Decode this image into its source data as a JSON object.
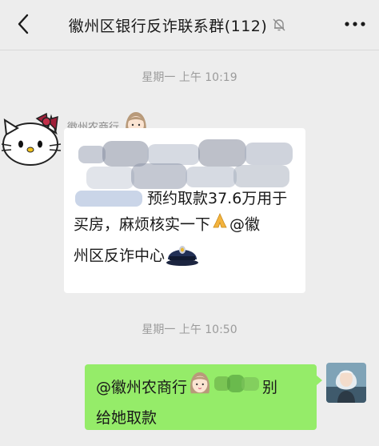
{
  "header": {
    "title": "徽州区银行反诈联系群(112)",
    "back_icon": "chevron-left-icon",
    "mute_icon": "bell-off-icon",
    "more_icon": "more-dots-icon"
  },
  "messages": [
    {
      "timestamp": "星期一 上午 10:19",
      "sender": "徽州农商行",
      "text_visible": "预约取款37.6万用于买房，麻烦核实一下",
      "line1": "预约取款37.6万用于",
      "line2": "买房，麻烦核实一下",
      "mention": "@徽",
      "line3": "州区反诈中心",
      "emoji": [
        "pray-hands",
        "police-officer"
      ]
    },
    {
      "timestamp": "星期一 上午 10:50",
      "line1_prefix": "@徽州农商行",
      "line1_suffix": "别",
      "line2": "给她取款"
    }
  ],
  "colors": {
    "background": "#ededed",
    "bubble_self": "#95ec69",
    "bubble_other": "#ffffff",
    "timestamp": "#9b9b9b"
  }
}
